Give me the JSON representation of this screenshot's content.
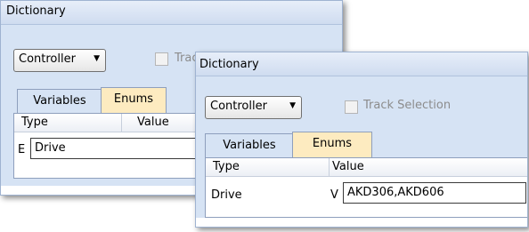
{
  "panel_back": {
    "title": "Dictionary",
    "controller_label": "Controller",
    "track_selection_label": "Track Selection",
    "tabs": [
      "Variables",
      "Enums"
    ],
    "columns": [
      "Type",
      "Value"
    ],
    "row": {
      "type_prefix": "E",
      "edit_value": "Drive"
    }
  },
  "panel_front": {
    "title": "Dictionary",
    "controller_label": "Controller",
    "track_selection_label": "Track Selection",
    "tabs": [
      "Variables",
      "Enums"
    ],
    "columns": [
      "Type",
      "Value"
    ],
    "row": {
      "type": "Drive",
      "value_prefix": "V",
      "edit_value": "AKD306,AKD606"
    }
  },
  "icons": {
    "dropdown": "chevron-down-icon",
    "checkbox": "checkbox-icon"
  },
  "colors": {
    "panel_bg": "#d6e3f4",
    "enums_tab_bg": "#fdebc0",
    "grid_bg": "#ffffff",
    "disabled_text": "#8c8c8c"
  }
}
